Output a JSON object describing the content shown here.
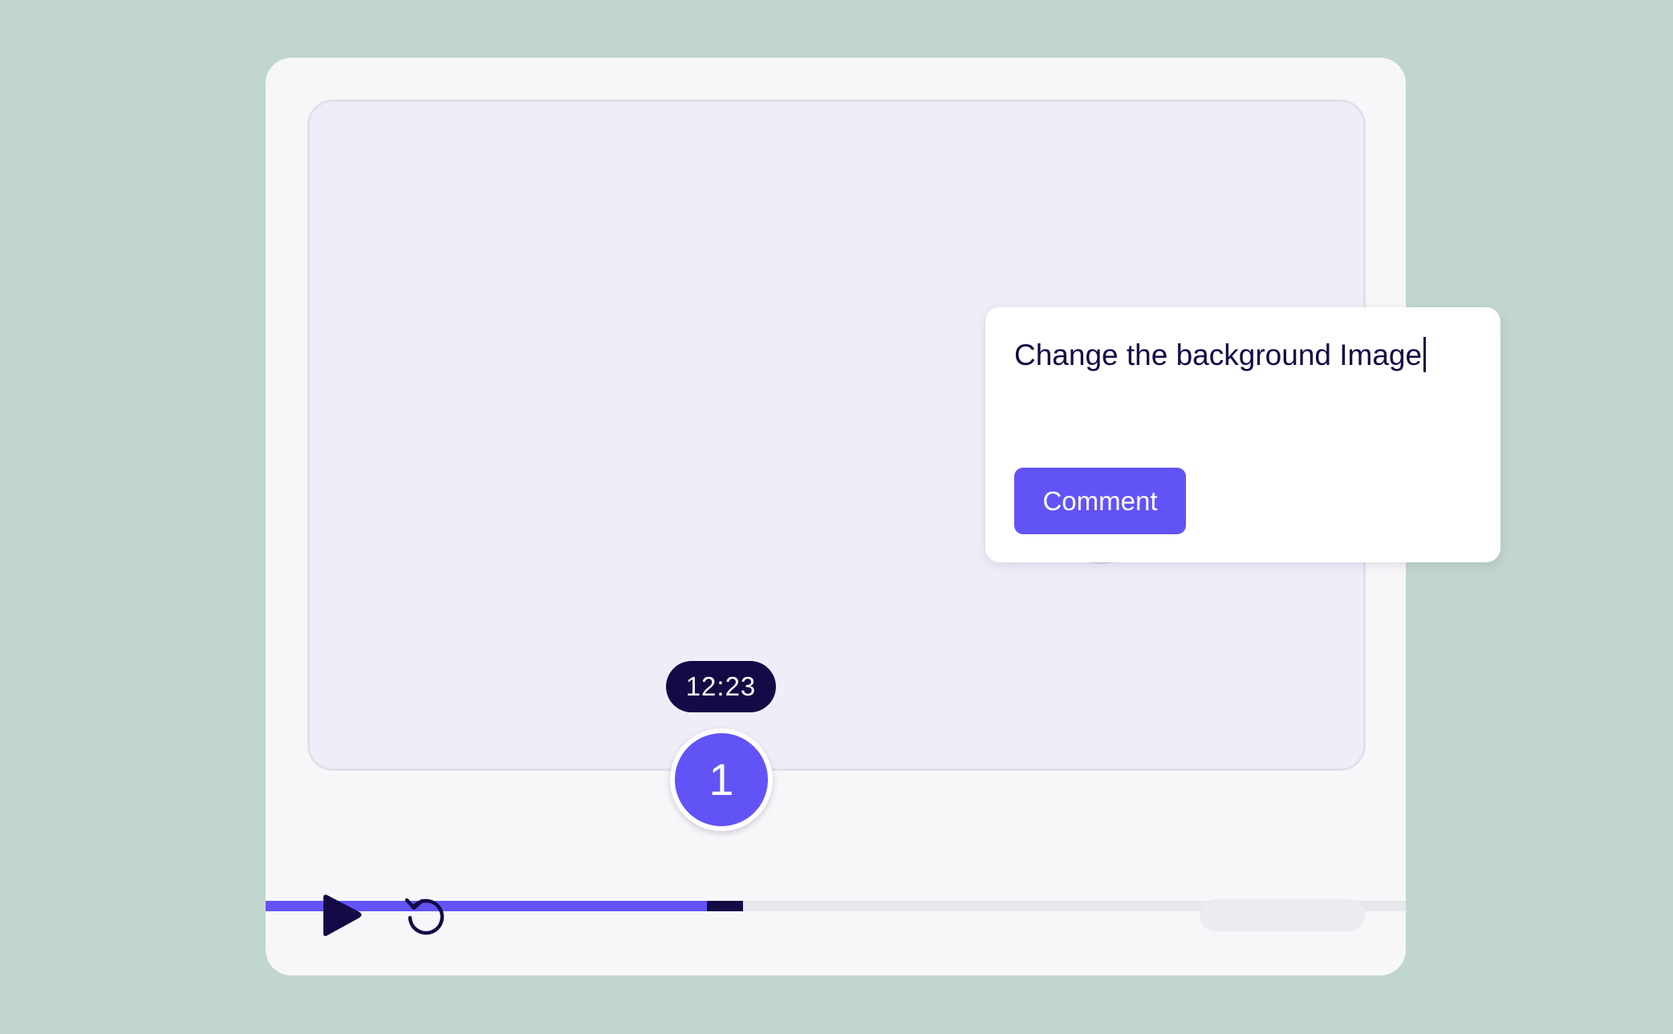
{
  "player": {
    "progress_fraction": 0.387,
    "icons": {
      "center_play": "play-icon",
      "control_play": "play-icon",
      "control_replay": "replay-icon"
    }
  },
  "marker": {
    "timestamp": "12:23",
    "number": "1"
  },
  "comment_popup": {
    "input_value": "Change the background Image",
    "button_label": "Comment"
  },
  "colors": {
    "background": "#c1d6cd",
    "accent": "#6253f7",
    "dark": "#140a45"
  }
}
